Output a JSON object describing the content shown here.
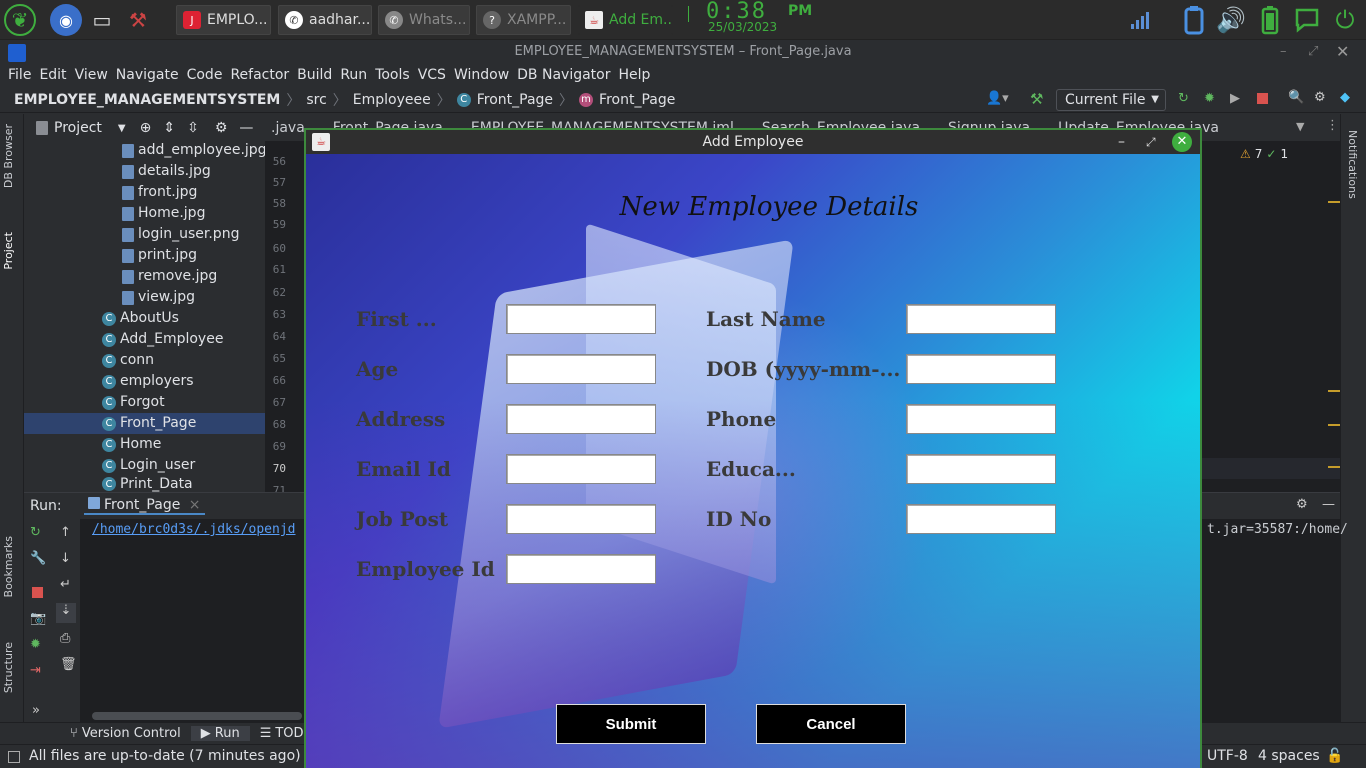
{
  "taskbar": {
    "tasks": [
      {
        "label": "EMPLO...",
        "icon": "intellij-icon"
      },
      {
        "label": "aadhar...",
        "icon": "whatsapp-icon"
      },
      {
        "label": "Whats...",
        "icon": "whatsapp-icon"
      },
      {
        "label": "XAMPP...",
        "icon": "xampp-icon"
      },
      {
        "label": "Add Em...",
        "icon": "java-icon"
      }
    ],
    "clock": {
      "time": "0:38",
      "ampm": "PM",
      "date": "25/03/2023"
    }
  },
  "ide": {
    "window_title": "EMPLOYEE_MANAGEMENTSYSTEM – Front_Page.java",
    "menu": [
      "File",
      "Edit",
      "View",
      "Navigate",
      "Code",
      "Refactor",
      "Build",
      "Run",
      "Tools",
      "VCS",
      "Window",
      "DB Navigator",
      "Help"
    ],
    "breadcrumb": [
      "EMPLOYEE_MANAGEMENTSYSTEM",
      "src",
      "Employeee",
      "Front_Page",
      "Front_Page"
    ],
    "run_config": "Current File",
    "project_label": "Project",
    "side_tabs": {
      "db_browser": "DB Browser",
      "project": "Project",
      "bookmarks": "Bookmarks",
      "structure": "Structure",
      "notifications": "Notifications"
    },
    "tree": [
      "add_employee.jpg",
      "details.jpg",
      "front.jpg",
      "Home.jpg",
      "login_user.png",
      "print.jpg",
      "remove.jpg",
      "view.jpg",
      "AboutUs",
      "Add_Employee",
      "conn",
      "employers",
      "Forgot",
      "Front_Page",
      "Home",
      "Login_user",
      "Print_Data"
    ],
    "editor_tabs": [
      ".java",
      "Front_Page.java",
      "EMPLOYEE_MANAGEMENTSYSTEM.iml",
      "Search_Employee.java",
      "Signup.java",
      "Update_Employee.java"
    ],
    "line_numbers": [
      "56",
      "57",
      "58",
      "59",
      "60",
      "61",
      "62",
      "63",
      "64",
      "65",
      "66",
      "67",
      "68",
      "69",
      "70",
      "71"
    ],
    "warnings": "7",
    "checks": "1",
    "run": {
      "label": "Run:",
      "tab": "Front_Page",
      "path": "/home/brc0d3s/.jdks/openjd",
      "path_right": "t.jar=35587:/home/"
    },
    "bottom_tabs": [
      "Version Control",
      "Run",
      "TODO"
    ],
    "status": {
      "message": "All files are up-to-date (7 minutes ago)",
      "encoding": "UTF-8",
      "indent": "4 spaces"
    }
  },
  "dialog": {
    "title": "Add Employee",
    "heading": "New Employee Details",
    "fields_left": [
      {
        "label": "First ...",
        "value": ""
      },
      {
        "label": "Age",
        "value": ""
      },
      {
        "label": "Address",
        "value": ""
      },
      {
        "label": "Email Id",
        "value": ""
      },
      {
        "label": "Job Post",
        "value": ""
      },
      {
        "label": "Employee Id",
        "value": ""
      }
    ],
    "fields_right": [
      {
        "label": "Last Name",
        "value": ""
      },
      {
        "label": "DOB (yyyy-mm-...",
        "value": ""
      },
      {
        "label": "Phone",
        "value": ""
      },
      {
        "label": "Educa...",
        "value": ""
      },
      {
        "label": "ID No",
        "value": ""
      }
    ],
    "submit_label": "Submit",
    "cancel_label": "Cancel"
  },
  "colors": {
    "accent_green": "#3fae3f",
    "selection": "#2e436e",
    "link": "#589df6"
  }
}
